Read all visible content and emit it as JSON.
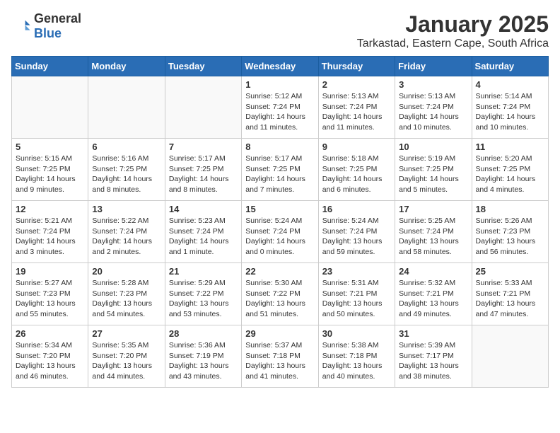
{
  "header": {
    "logo_general": "General",
    "logo_blue": "Blue",
    "month": "January 2025",
    "location": "Tarkastad, Eastern Cape, South Africa"
  },
  "weekdays": [
    "Sunday",
    "Monday",
    "Tuesday",
    "Wednesday",
    "Thursday",
    "Friday",
    "Saturday"
  ],
  "weeks": [
    [
      {
        "day": "",
        "info": ""
      },
      {
        "day": "",
        "info": ""
      },
      {
        "day": "",
        "info": ""
      },
      {
        "day": "1",
        "info": "Sunrise: 5:12 AM\nSunset: 7:24 PM\nDaylight: 14 hours\nand 11 minutes."
      },
      {
        "day": "2",
        "info": "Sunrise: 5:13 AM\nSunset: 7:24 PM\nDaylight: 14 hours\nand 11 minutes."
      },
      {
        "day": "3",
        "info": "Sunrise: 5:13 AM\nSunset: 7:24 PM\nDaylight: 14 hours\nand 10 minutes."
      },
      {
        "day": "4",
        "info": "Sunrise: 5:14 AM\nSunset: 7:24 PM\nDaylight: 14 hours\nand 10 minutes."
      }
    ],
    [
      {
        "day": "5",
        "info": "Sunrise: 5:15 AM\nSunset: 7:25 PM\nDaylight: 14 hours\nand 9 minutes."
      },
      {
        "day": "6",
        "info": "Sunrise: 5:16 AM\nSunset: 7:25 PM\nDaylight: 14 hours\nand 8 minutes."
      },
      {
        "day": "7",
        "info": "Sunrise: 5:17 AM\nSunset: 7:25 PM\nDaylight: 14 hours\nand 8 minutes."
      },
      {
        "day": "8",
        "info": "Sunrise: 5:17 AM\nSunset: 7:25 PM\nDaylight: 14 hours\nand 7 minutes."
      },
      {
        "day": "9",
        "info": "Sunrise: 5:18 AM\nSunset: 7:25 PM\nDaylight: 14 hours\nand 6 minutes."
      },
      {
        "day": "10",
        "info": "Sunrise: 5:19 AM\nSunset: 7:25 PM\nDaylight: 14 hours\nand 5 minutes."
      },
      {
        "day": "11",
        "info": "Sunrise: 5:20 AM\nSunset: 7:25 PM\nDaylight: 14 hours\nand 4 minutes."
      }
    ],
    [
      {
        "day": "12",
        "info": "Sunrise: 5:21 AM\nSunset: 7:24 PM\nDaylight: 14 hours\nand 3 minutes."
      },
      {
        "day": "13",
        "info": "Sunrise: 5:22 AM\nSunset: 7:24 PM\nDaylight: 14 hours\nand 2 minutes."
      },
      {
        "day": "14",
        "info": "Sunrise: 5:23 AM\nSunset: 7:24 PM\nDaylight: 14 hours\nand 1 minute."
      },
      {
        "day": "15",
        "info": "Sunrise: 5:24 AM\nSunset: 7:24 PM\nDaylight: 14 hours\nand 0 minutes."
      },
      {
        "day": "16",
        "info": "Sunrise: 5:24 AM\nSunset: 7:24 PM\nDaylight: 13 hours\nand 59 minutes."
      },
      {
        "day": "17",
        "info": "Sunrise: 5:25 AM\nSunset: 7:24 PM\nDaylight: 13 hours\nand 58 minutes."
      },
      {
        "day": "18",
        "info": "Sunrise: 5:26 AM\nSunset: 7:23 PM\nDaylight: 13 hours\nand 56 minutes."
      }
    ],
    [
      {
        "day": "19",
        "info": "Sunrise: 5:27 AM\nSunset: 7:23 PM\nDaylight: 13 hours\nand 55 minutes."
      },
      {
        "day": "20",
        "info": "Sunrise: 5:28 AM\nSunset: 7:23 PM\nDaylight: 13 hours\nand 54 minutes."
      },
      {
        "day": "21",
        "info": "Sunrise: 5:29 AM\nSunset: 7:22 PM\nDaylight: 13 hours\nand 53 minutes."
      },
      {
        "day": "22",
        "info": "Sunrise: 5:30 AM\nSunset: 7:22 PM\nDaylight: 13 hours\nand 51 minutes."
      },
      {
        "day": "23",
        "info": "Sunrise: 5:31 AM\nSunset: 7:21 PM\nDaylight: 13 hours\nand 50 minutes."
      },
      {
        "day": "24",
        "info": "Sunrise: 5:32 AM\nSunset: 7:21 PM\nDaylight: 13 hours\nand 49 minutes."
      },
      {
        "day": "25",
        "info": "Sunrise: 5:33 AM\nSunset: 7:21 PM\nDaylight: 13 hours\nand 47 minutes."
      }
    ],
    [
      {
        "day": "26",
        "info": "Sunrise: 5:34 AM\nSunset: 7:20 PM\nDaylight: 13 hours\nand 46 minutes."
      },
      {
        "day": "27",
        "info": "Sunrise: 5:35 AM\nSunset: 7:20 PM\nDaylight: 13 hours\nand 44 minutes."
      },
      {
        "day": "28",
        "info": "Sunrise: 5:36 AM\nSunset: 7:19 PM\nDaylight: 13 hours\nand 43 minutes."
      },
      {
        "day": "29",
        "info": "Sunrise: 5:37 AM\nSunset: 7:18 PM\nDaylight: 13 hours\nand 41 minutes."
      },
      {
        "day": "30",
        "info": "Sunrise: 5:38 AM\nSunset: 7:18 PM\nDaylight: 13 hours\nand 40 minutes."
      },
      {
        "day": "31",
        "info": "Sunrise: 5:39 AM\nSunset: 7:17 PM\nDaylight: 13 hours\nand 38 minutes."
      },
      {
        "day": "",
        "info": ""
      }
    ]
  ]
}
